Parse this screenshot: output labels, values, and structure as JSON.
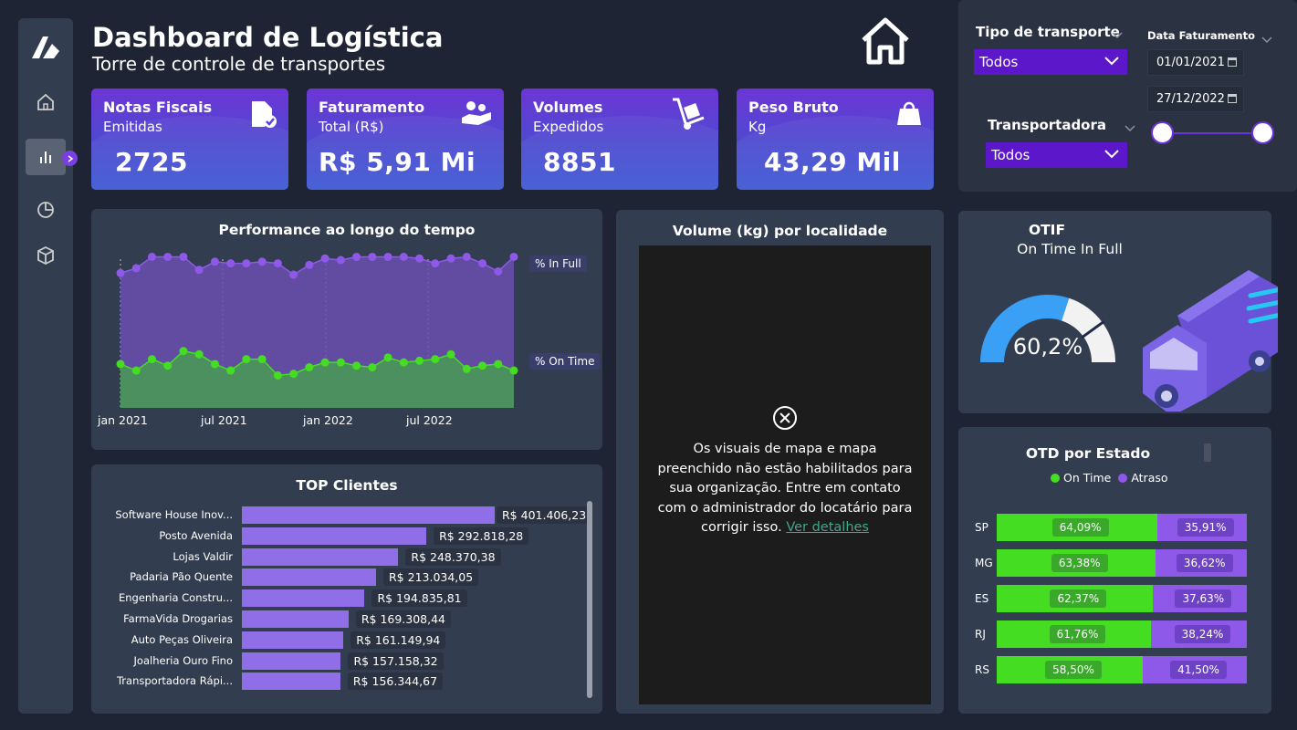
{
  "header": {
    "title": "Dashboard de Logística",
    "subtitle": "Torre de controle de transportes"
  },
  "sidebar": {
    "items": [
      {
        "name": "home-icon"
      },
      {
        "name": "bar-chart-icon"
      },
      {
        "name": "pie-chart-icon"
      },
      {
        "name": "box-icon"
      }
    ]
  },
  "cards": [
    {
      "line1": "Notas Fiscais",
      "line2": "Emitidas",
      "value": "2725",
      "icon": "document-check-icon"
    },
    {
      "line1": "Faturamento",
      "line2": "Total (R$)",
      "value": "R$ 5,91 Mi",
      "icon": "hand-money-icon"
    },
    {
      "line1": "Volumes",
      "line2": "Expedidos",
      "value": "8851",
      "icon": "hand-truck-icon"
    },
    {
      "line1": "Peso Bruto",
      "line2": "Kg",
      "value": "43,29 Mil",
      "icon": "weight-bag-icon"
    }
  ],
  "filters": {
    "transport_label": "Tipo de transporte",
    "transport_value": "Todos",
    "carrier_label": "Transportadora",
    "carrier_value": "Todos",
    "date_label": "Data Faturamento",
    "date_start": "01/01/2021",
    "date_end": "27/12/2022"
  },
  "performance": {
    "title": "Performance ao longo do tempo",
    "legend_infull": "% In Full",
    "legend_ontime": "% On Time",
    "x_ticks": [
      "jan 2021",
      "jul 2021",
      "jan 2022",
      "jul 2022"
    ]
  },
  "top_clients": {
    "title": "TOP Clientes"
  },
  "map": {
    "title": "Volume (kg) por localidade",
    "message": "Os visuais de mapa e mapa preenchido não estão habilitados para sua organização. Entre em contato com o administrador do locatário para corrigir isso.",
    "link": "Ver detalhes"
  },
  "otif": {
    "title": "OTIF",
    "subtitle": "On Time In Full",
    "value_text": "60,2%"
  },
  "otd": {
    "title": "OTD por Estado",
    "legend_on_time": "On Time",
    "legend_delay": "Atraso"
  },
  "colors": {
    "in_full": "#8e58e8",
    "on_time": "#44dd22",
    "bar": "#8f6ee8",
    "gauge": "#3aa0f5",
    "card_top": "#6d35d6",
    "card_bottom": "#3f5ad4"
  },
  "chart_data": [
    {
      "type": "area",
      "title": "Performance ao longo do tempo",
      "x_ticks": [
        "jan 2021",
        "jul 2021",
        "jan 2022",
        "jul 2022"
      ],
      "series": [
        {
          "name": "% In Full",
          "values": [
            83,
            86,
            93,
            93,
            93,
            85,
            90,
            89,
            89,
            90,
            89,
            82,
            88,
            92,
            91,
            93,
            93,
            93,
            93,
            92,
            89,
            92,
            93,
            89,
            84,
            93
          ]
        },
        {
          "name": "% On Time",
          "values": [
            27,
            23,
            30,
            26,
            35,
            33,
            27,
            23,
            30,
            30,
            20,
            21,
            25,
            28,
            28,
            26,
            25,
            31,
            28,
            29,
            30,
            33,
            24,
            26,
            27,
            23
          ]
        }
      ]
    },
    {
      "type": "bar",
      "title": "TOP Clientes",
      "categories": [
        "Software House Inov...",
        "Posto Avenida",
        "Lojas Valdir",
        "Padaria Pão Quente",
        "Engenharia Constru...",
        "FarmaVida Drogarias",
        "Auto Peças Oliveira",
        "Joalheria Ouro Fino",
        "Transportadora Rápi..."
      ],
      "values": [
        401406.23,
        292818.28,
        248370.38,
        213034.05,
        194835.81,
        169308.44,
        161149.94,
        157158.32,
        156344.67
      ],
      "labels": [
        "R$ 401.406,23",
        "R$ 292.818,28",
        "R$ 248.370,38",
        "R$ 213.034,05",
        "R$ 194.835,81",
        "R$ 169.308,44",
        "R$ 161.149,94",
        "R$ 157.158,32",
        "R$ 156.344,67"
      ]
    },
    {
      "type": "gauge",
      "title": "OTIF",
      "value": 60.2,
      "target": 80,
      "max": 100
    },
    {
      "type": "bar",
      "title": "OTD por Estado",
      "categories": [
        "SP",
        "MG",
        "ES",
        "RJ",
        "RS"
      ],
      "series": [
        {
          "name": "On Time",
          "values": [
            64.09,
            63.38,
            62.37,
            61.76,
            58.5
          ],
          "labels": [
            "64,09%",
            "63,38%",
            "62,37%",
            "61,76%",
            "58,50%"
          ]
        },
        {
          "name": "Atraso",
          "values": [
            35.91,
            36.62,
            37.63,
            38.24,
            41.5
          ],
          "labels": [
            "35,91%",
            "36,62%",
            "37,63%",
            "38,24%",
            "41,50%"
          ]
        }
      ]
    }
  ]
}
